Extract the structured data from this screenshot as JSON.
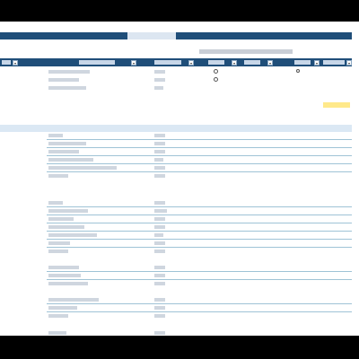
{
  "title": "",
  "corner_text": "",
  "subnote": "",
  "columns": [
    {
      "label": ""
    },
    {
      "label": ""
    },
    {
      "label": ""
    },
    {
      "label": ""
    },
    {
      "label": ""
    },
    {
      "label": ""
    },
    {
      "label": ""
    }
  ],
  "filter_glyph": "▾",
  "colors": {
    "header_blue": "#1f4e79",
    "band_blue": "#dbe8f4",
    "highlight_yellow": "#ffe98a",
    "rule_teal": "#9fc3d6"
  }
}
